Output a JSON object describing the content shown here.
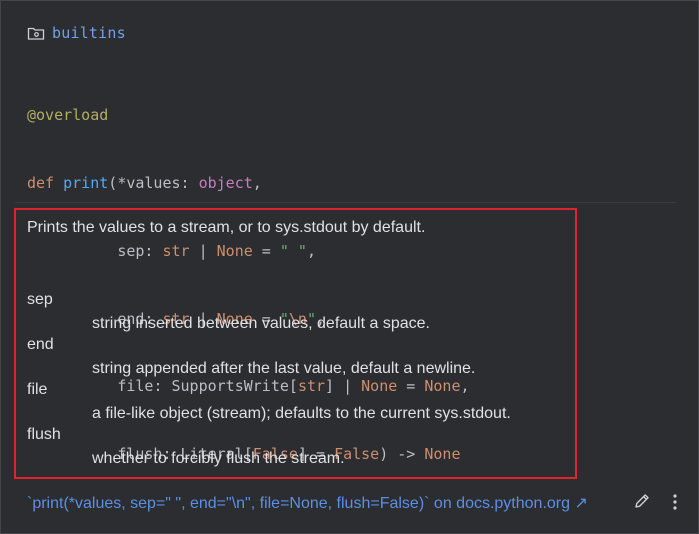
{
  "header": {
    "module": "builtins"
  },
  "signature": {
    "decorator": "@overload",
    "def_kw": "def",
    "func_name": "print",
    "paren_open": "(",
    "star_values": "*values",
    "colon": ": ",
    "object_type": "object",
    "comma": ",",
    "sep_name": "sep",
    "str_type": "str",
    "pipe": " | ",
    "none_kw": "None",
    "eq": " = ",
    "sep_default": "\" \"",
    "end_name": "end",
    "end_default_open": "\"",
    "end_default_escape": "\\n",
    "end_default_close": "\"",
    "file_name": "file",
    "supportswrite": "SupportsWrite",
    "bracket_open": "[",
    "bracket_close": "]",
    "flush_name": "flush",
    "literal": "Literal",
    "false_kw": "False",
    "arrow": ") -> ",
    "return_none": "None"
  },
  "doc": {
    "summary": "Prints the values to a stream, or to sys.stdout by default.",
    "params": [
      {
        "name": "sep",
        "desc": "string inserted between values, default a space."
      },
      {
        "name": "end",
        "desc": "string appended after the last value, default a newline."
      },
      {
        "name": "file",
        "desc": "a file-like object (stream); defaults to the current sys.stdout."
      },
      {
        "name": "flush",
        "desc": "whether to forcibly flush the stream."
      }
    ]
  },
  "footer": {
    "link_text": "`print(*values, sep=\" \", end=\"\\n\", file=None, flush=False)` on docs.python.org ↗"
  },
  "icons": {
    "folder": "folder-icon",
    "edit": "pencil-icon",
    "more": "more-vertical-icon"
  },
  "colors": {
    "background": "#2b2d30",
    "module": "#6fa2e8",
    "keyword": "#cf8e6d",
    "function": "#56a8f5",
    "decorator": "#b3ae60",
    "type": "#c77dbb",
    "string": "#6aab73",
    "link": "#5c8fe3",
    "highlight_border": "#e0242f"
  }
}
